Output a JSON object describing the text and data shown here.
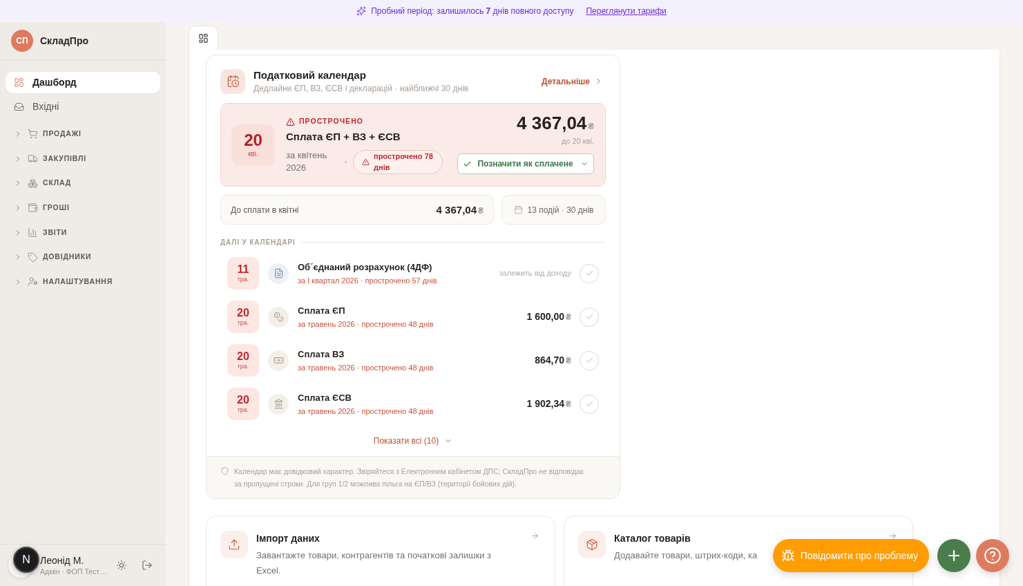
{
  "trial_banner": {
    "text": "Пробний період: залишилось **7** днів повного доступу",
    "link": "Переглянути тарифи"
  },
  "sidebar": {
    "logo": {
      "initials": "СП",
      "name": "СкладПро"
    },
    "items": [
      {
        "label": "Дашборд",
        "selected": true
      },
      {
        "label": "Вхідні",
        "selected": false
      }
    ],
    "groups": [
      {
        "label": "ПРОДАЖІ",
        "expanded": false
      },
      {
        "label": "ЗАКУПІВЛІ",
        "expanded": false
      },
      {
        "label": "СКЛАД",
        "expanded": false
      },
      {
        "label": "ГРОШІ",
        "expanded": false
      },
      {
        "label": "ЗВІТИ",
        "expanded": false
      },
      {
        "label": "ДОВІДНИКИ",
        "expanded": false
      },
      {
        "label": "НАЛАШТУВАННЯ",
        "expanded": false
      }
    ],
    "user": {
      "name": "Леонід М.",
      "role": "Адмін · ФОП Тест…"
    }
  },
  "dev_badge": {
    "label": "N"
  },
  "view_tabs": [
    {
      "selected": true
    }
  ],
  "tax_calendar": {
    "title": "Податковий календар",
    "subtitle": "Дедлайни ЄП, ВЗ, ЄСВ і декларацій · найближчі 30 днів",
    "details_link": "Детальніше",
    "overdue": {
      "day": "20",
      "month": "кві.",
      "status": "ПРОСТРОЧЕНО",
      "title": "Сплата ЄП + ВЗ + ЄСВ",
      "period": "за квітень 2026",
      "badge": "прострочено 78 днів",
      "amount": "4 367,04",
      "currency": "₴",
      "due": "до 20 кві.",
      "action": "Позначити як сплачене"
    },
    "summary": {
      "label": "До сплати в квітні",
      "amount": "4 367,04",
      "currency": "₴"
    },
    "events_count": "13 подій · 30 днів",
    "upcoming_heading": "ДАЛІ У КАЛЕНДАРІ",
    "upcoming": [
      {
        "kind": "document",
        "day": "11",
        "month": "тра.",
        "title": "Об΄єднаний розрахунок (4ДФ)",
        "detail": "за I квартал 2026 · прострочено 57 днів",
        "note": "залежить від доходу",
        "done": false
      },
      {
        "kind": "coins",
        "day": "20",
        "month": "тра.",
        "title": "Сплата ЄП",
        "detail": "за травень 2026 · прострочено 48 днів",
        "amount": "1 600,00",
        "currency": "₴",
        "done": false
      },
      {
        "kind": "banknote",
        "day": "20",
        "month": "тра.",
        "title": "Сплата ВЗ",
        "detail": "за травень 2026 · прострочено 48 днів",
        "amount": "864,70",
        "currency": "₴",
        "done": false
      },
      {
        "kind": "bank",
        "day": "20",
        "month": "тра.",
        "title": "Сплата ЄСВ",
        "detail": "за травень 2026 · прострочено 48 днів",
        "amount": "1 902,34",
        "currency": "₴",
        "done": false
      }
    ],
    "show_all": "Показати всі (10)",
    "disclaimer": "Календар має довідковий характер. Звіряйтеся з Електронним кабінетом ДПС; СкладПро не відповідає за пропущені строки. Для груп 1/2 можлива пільга на ЄП/ВЗ (території бойових дій)."
  },
  "quick_actions": [
    {
      "kind": "import",
      "title": "Імпорт даних",
      "description": "Завантажте товари, контрагентів та початкові залишки з Excel."
    },
    {
      "kind": "catalog",
      "title": "Каталог товарів",
      "description": "Додавайте товари, штрих-коди, ка"
    }
  ],
  "report_button": "Повідомити про проблему"
}
